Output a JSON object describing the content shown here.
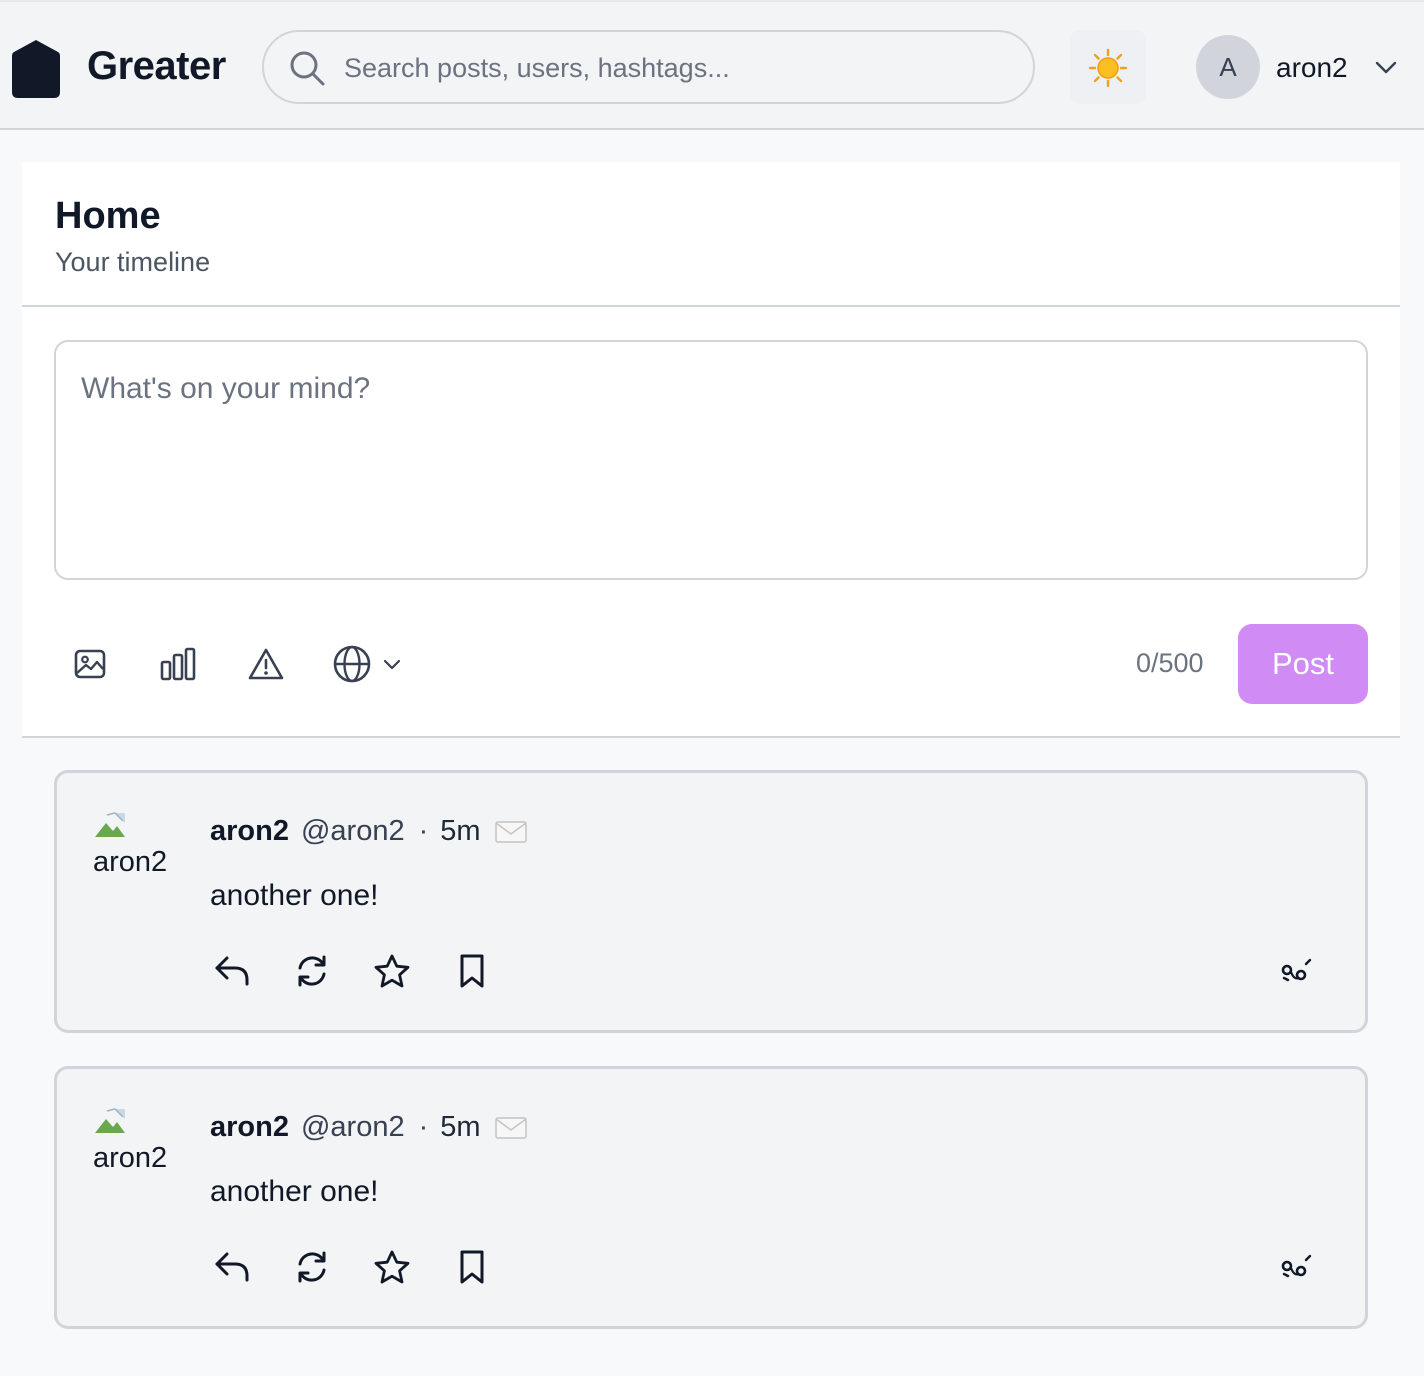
{
  "header": {
    "brand": "Greater",
    "search_placeholder": "Search posts, users, hashtags...",
    "theme_icon": "sun-icon",
    "user": {
      "initial": "A",
      "name": "aron2"
    }
  },
  "main": {
    "title": "Home",
    "subtitle": "Your timeline",
    "composer": {
      "placeholder": "What's on your mind?",
      "value": "",
      "tools": [
        "image-icon",
        "poll-icon",
        "content-warning-icon",
        "visibility-globe-icon"
      ],
      "counter": "0/500",
      "post_label": "Post"
    }
  },
  "posts": [
    {
      "avatar_alt": "aron2",
      "author": "aron2",
      "handle": "@aron2",
      "separator": "·",
      "time": "5m",
      "visibility_icon": "envelope-icon",
      "body": "another one!",
      "actions": [
        "reply-icon",
        "boost-icon",
        "favourite-icon",
        "bookmark-icon",
        "more-icon"
      ]
    },
    {
      "avatar_alt": "aron2",
      "author": "aron2",
      "handle": "@aron2",
      "separator": "·",
      "time": "5m",
      "visibility_icon": "envelope-icon",
      "body": "another one!",
      "actions": [
        "reply-icon",
        "boost-icon",
        "favourite-icon",
        "bookmark-icon",
        "more-icon"
      ]
    }
  ],
  "colors": {
    "accent": "#d08bf5",
    "text": "#111827",
    "muted": "#6b7280",
    "border": "#d1d5db"
  }
}
